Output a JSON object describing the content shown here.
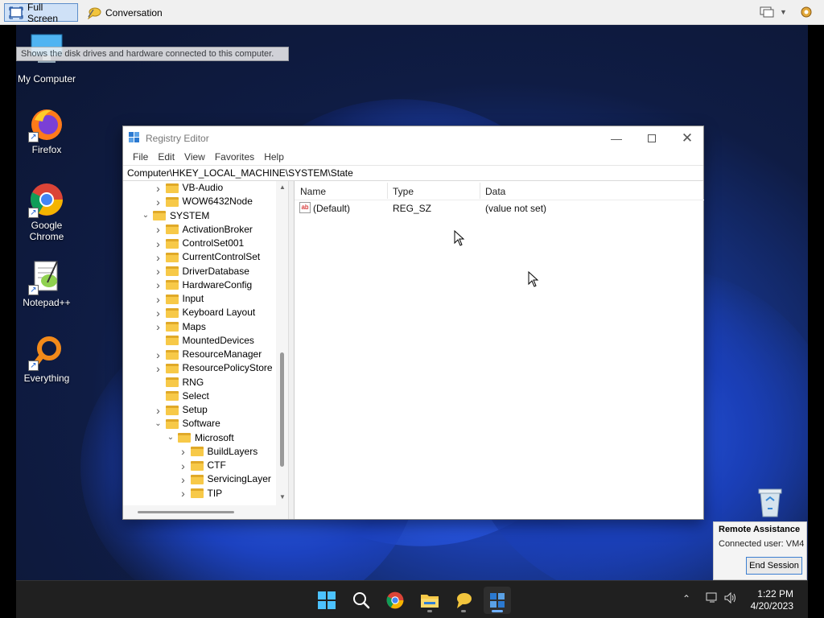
{
  "ra_toolbar": {
    "fullscreen_label": "Full Screen",
    "conversation_label": "Conversation"
  },
  "desktop": {
    "tooltip": "Shows the disk drives and hardware connected to this computer.",
    "icons": [
      {
        "label": "My Computer"
      },
      {
        "label": "Firefox"
      },
      {
        "label": "Google Chrome"
      },
      {
        "label": "Notepad++"
      },
      {
        "label": "Everything"
      }
    ]
  },
  "regedit": {
    "title": "Registry Editor",
    "menu": [
      "File",
      "Edit",
      "View",
      "Favorites",
      "Help"
    ],
    "address": "Computer\\HKEY_LOCAL_MACHINE\\SYSTEM\\State",
    "tree": [
      {
        "label": "VB-Audio",
        "chevron": ">"
      },
      {
        "label": "WOW6432Node",
        "chevron": ">"
      },
      {
        "label": "SYSTEM",
        "chevron": "v"
      },
      {
        "label": "ActivationBroker",
        "chevron": ">"
      },
      {
        "label": "ControlSet001",
        "chevron": ">"
      },
      {
        "label": "CurrentControlSet",
        "chevron": ">"
      },
      {
        "label": "DriverDatabase",
        "chevron": ">"
      },
      {
        "label": "HardwareConfig",
        "chevron": ">"
      },
      {
        "label": "Input",
        "chevron": ">"
      },
      {
        "label": "Keyboard Layout",
        "chevron": ">"
      },
      {
        "label": "Maps",
        "chevron": ">"
      },
      {
        "label": "MountedDevices",
        "chevron": ""
      },
      {
        "label": "ResourceManager",
        "chevron": ">"
      },
      {
        "label": "ResourcePolicyStore",
        "chevron": ">"
      },
      {
        "label": "RNG",
        "chevron": ""
      },
      {
        "label": "Select",
        "chevron": ""
      },
      {
        "label": "Setup",
        "chevron": ">"
      },
      {
        "label": "Software",
        "chevron": "v"
      },
      {
        "label": "Microsoft",
        "chevron": "v"
      },
      {
        "label": "BuildLayers",
        "chevron": ">"
      },
      {
        "label": "CTF",
        "chevron": ">"
      },
      {
        "label": "ServicingLayer",
        "chevron": ">"
      },
      {
        "label": "TIP",
        "chevron": ">"
      }
    ],
    "columns": {
      "name": "Name",
      "type": "Type",
      "data": "Data"
    },
    "values": [
      {
        "name": "(Default)",
        "type": "REG_SZ",
        "data": "(value not set)"
      }
    ]
  },
  "ra_panel": {
    "title": "Remote Assistance",
    "connected": "Connected user:  VM4",
    "end_session": "End Session"
  },
  "taskbar": {
    "time": "1:22 PM",
    "date": "4/20/2023"
  }
}
